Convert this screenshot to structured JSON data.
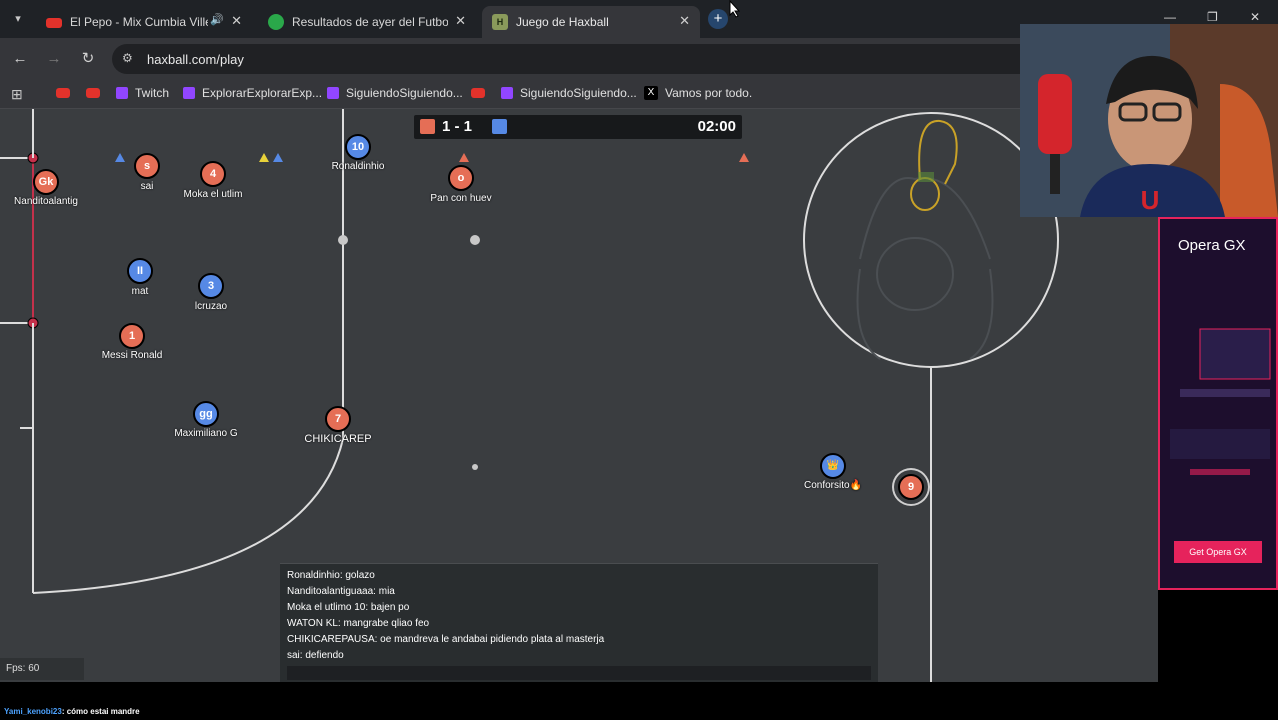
{
  "browser": {
    "tabs": [
      {
        "title": "El Pepo - Mix Cumbia Villera",
        "favicon": "youtube-icon",
        "audio": true,
        "active": false
      },
      {
        "title": "Resultados de ayer del Futbol A",
        "favicon": "soccer-ball-icon",
        "audio": false,
        "active": false
      },
      {
        "title": "Juego de Haxball",
        "favicon": "haxball-icon",
        "audio": false,
        "active": true
      }
    ],
    "new_tab_label": "+",
    "address": "haxball.com/play",
    "bookmarks": [
      {
        "label": "",
        "icon": "youtube-icon"
      },
      {
        "label": "",
        "icon": "youtube-icon"
      },
      {
        "label": "Twitch",
        "icon": "twitch-icon"
      },
      {
        "label": "ExplorarExplorarExp...",
        "icon": "twitch-icon"
      },
      {
        "label": "SiguiendoSiguiendo...",
        "icon": "twitch-icon"
      },
      {
        "label": "",
        "icon": "youtube-icon"
      },
      {
        "label": "SiguiendoSiguiendo...",
        "icon": "twitch-icon"
      },
      {
        "label": "Vamos por todo.",
        "icon": "x-icon"
      }
    ]
  },
  "game": {
    "score": "1 - 1",
    "time": "02:00",
    "players": [
      {
        "label": "Gk",
        "name": "Nanditoalantig",
        "team": "red"
      },
      {
        "label": "s",
        "name": "sai",
        "team": "red"
      },
      {
        "label": "4",
        "name": "Moka el utlim",
        "team": "red"
      },
      {
        "label": "10",
        "name": "Ronaldinhio",
        "team": "blue"
      },
      {
        "label": "o",
        "name": "Pan con huev",
        "team": "red"
      },
      {
        "label": "II",
        "name": "mat",
        "team": "blue"
      },
      {
        "label": "3",
        "name": "lcruzao",
        "team": "blue"
      },
      {
        "label": "1",
        "name": "Messi Ronald",
        "team": "red"
      },
      {
        "label": "gg",
        "name": "Maximiliano G",
        "team": "blue"
      },
      {
        "label": "7",
        "name": "CHIKICAREP",
        "team": "red"
      },
      {
        "label": "👑",
        "name": "Conforsito🔥",
        "team": "blue"
      },
      {
        "label": "9",
        "name": "",
        "team": "red"
      }
    ],
    "fps": "Fps: 60",
    "chat": [
      "Ronaldinhio: golazo",
      "Nanditoalantiguaaa: mia",
      "Moka el utlimo 10: bajen po",
      "WATON KL: mangrabe qliao feo",
      "CHIKICAREPAUSA: oe mandreva le andabai pidiendo plata al masterja",
      "sai: defiendo"
    ]
  },
  "ad": {
    "brand": "Opera GX",
    "cta": "Get Opera GX"
  },
  "stream_chat": {
    "user": "Yami_kenobi23",
    "message": ": cómo estai mandre"
  },
  "colors": {
    "red_team": "#e56e56",
    "blue_team": "#5689e5",
    "field": "#3a3d40",
    "ad_accent": "#e6235c"
  }
}
